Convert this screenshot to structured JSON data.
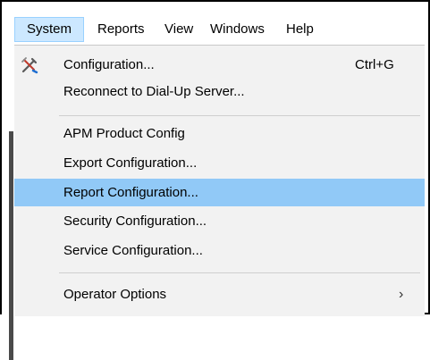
{
  "menubar": {
    "items": [
      {
        "label": "System",
        "active": true
      },
      {
        "label": "Reports"
      },
      {
        "label": "View"
      },
      {
        "label": "Windows"
      },
      {
        "label": "Help"
      }
    ]
  },
  "menu": {
    "items": [
      {
        "label": "Configuration...",
        "shortcut": "Ctrl+G",
        "icon": "tools-icon"
      },
      {
        "label": "Reconnect to Dial-Up Server..."
      },
      {
        "label": "APM Product Config"
      },
      {
        "label": "Export Configuration..."
      },
      {
        "label": "Report Configuration...",
        "highlighted": true
      },
      {
        "label": "Security Configuration..."
      },
      {
        "label": "Service Configuration..."
      },
      {
        "label": "Operator Options",
        "submenu_arrow": "›"
      }
    ]
  },
  "colors": {
    "menu_background": "#f2f2f2",
    "highlight": "#91c9f7",
    "menubar_active": "#cce8ff"
  }
}
